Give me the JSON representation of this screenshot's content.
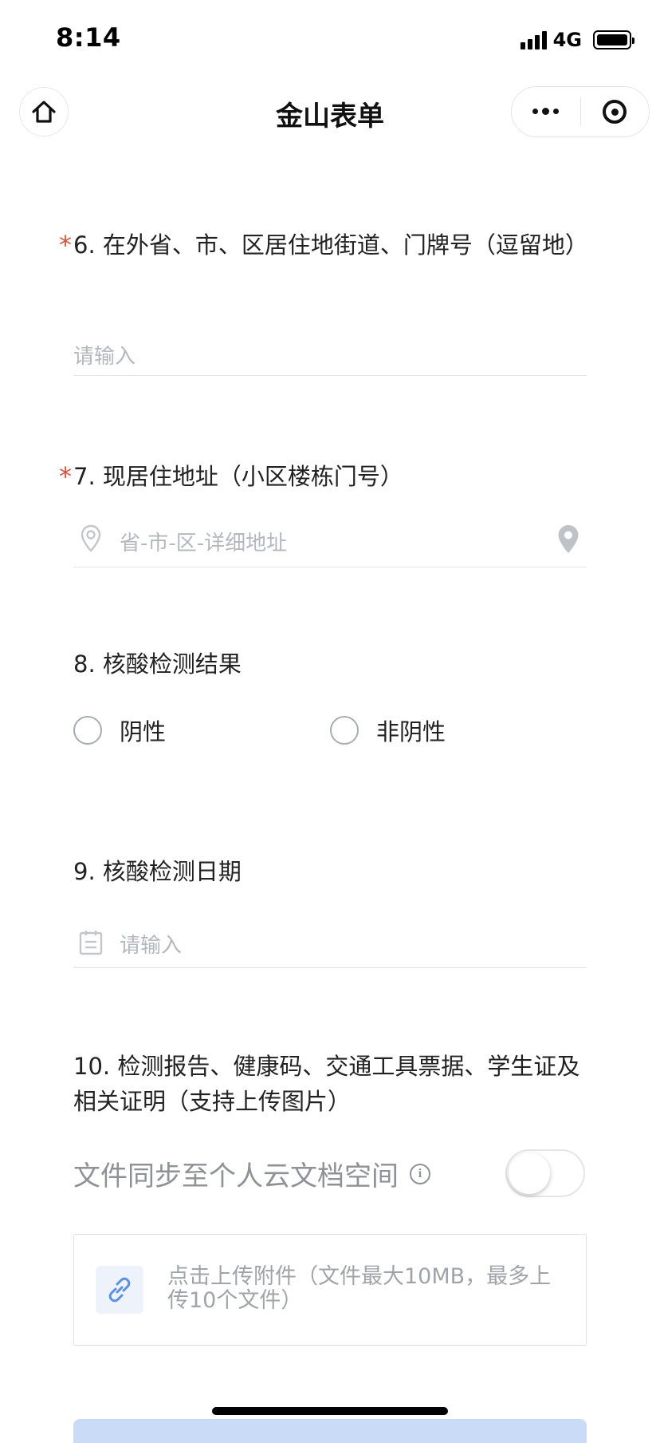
{
  "status_bar": {
    "time": "8:14",
    "network": "4G"
  },
  "nav": {
    "title": "金山表单",
    "home_icon": "home-icon",
    "more_icon": "more-dots-icon",
    "close_icon": "target-close-icon"
  },
  "q6": {
    "required_mark": "*",
    "title": "6. 在外省、市、区居住地街道、门牌号（逗留地）",
    "placeholder": "请输入"
  },
  "q7": {
    "required_mark": "*",
    "title": "7. 现居住地址（小区楼栋门号）",
    "placeholder": "省-市-区-详细地址"
  },
  "q8": {
    "title": "8. 核酸检测结果",
    "options": [
      "阴性",
      "非阴性"
    ]
  },
  "q9": {
    "title": "9. 核酸检测日期",
    "placeholder": "请输入"
  },
  "q10": {
    "title": "10. 检测报告、健康码、交通工具票据、学生证及相关证明（支持上传图片）",
    "sync_label": "文件同步至个人云文档空间",
    "info_glyph": "i",
    "upload_text": "点击上传附件（文件最大10MB，最多上传10个文件）"
  },
  "colors": {
    "required": "#d5553d",
    "placeholder": "#b4b8bd",
    "accent_light": "#c9dbf6"
  }
}
